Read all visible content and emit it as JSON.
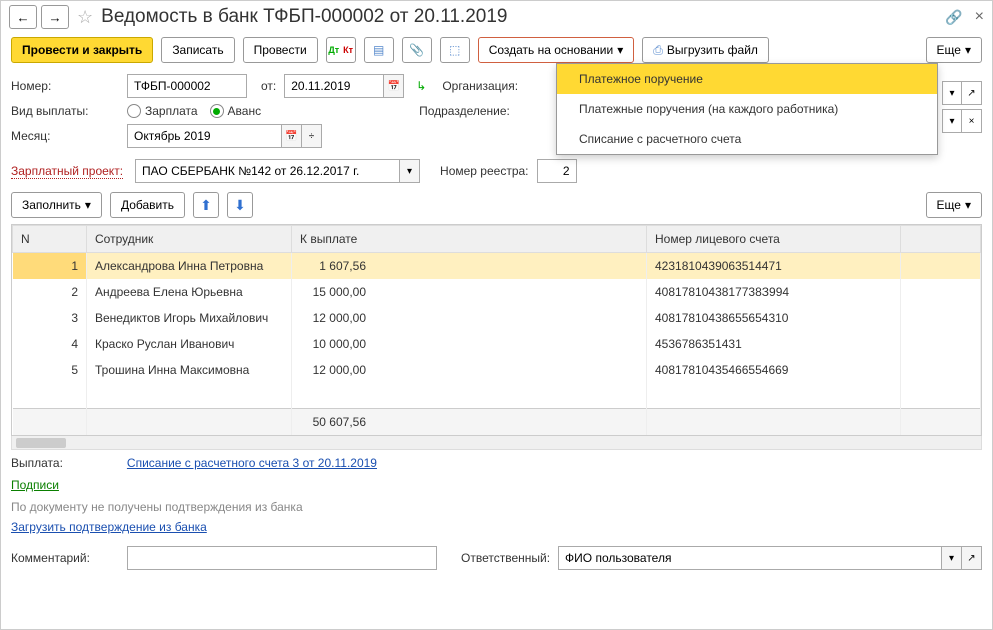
{
  "header": {
    "title": "Ведомость в банк ТФБП-000002 от 20.11.2019"
  },
  "toolbar": {
    "post_close": "Провести и закрыть",
    "save": "Записать",
    "post": "Провести",
    "create_based": "Создать на основании",
    "upload": "Выгрузить файл",
    "more": "Еще"
  },
  "dropdown": {
    "item1": "Платежное поручение",
    "item2": "Платежные поручения (на каждого работника)",
    "item3": "Списание с расчетного счета"
  },
  "form": {
    "number_label": "Номер:",
    "number_value": "ТФБП-000002",
    "from_label": "от:",
    "date_value": "20.11.2019",
    "org_label": "Организация:",
    "paytype_label": "Вид выплаты:",
    "radio_salary": "Зарплата",
    "radio_advance": "Аванс",
    "dept_label": "Подразделение:",
    "month_label": "Месяц:",
    "month_value": "Октябрь 2019",
    "project_label": "Зарплатный проект:",
    "project_value": "ПАО СБЕРБАНК №142 от 26.12.2017 г.",
    "registry_label": "Номер реестра:",
    "registry_value": "2"
  },
  "sec_toolbar": {
    "fill": "Заполнить",
    "add": "Добавить",
    "more2": "Еще"
  },
  "table": {
    "col_n": "N",
    "col_emp": "Сотрудник",
    "col_pay": "К выплате",
    "col_acc": "Номер лицевого счета",
    "rows": [
      {
        "n": "1",
        "emp": "Александрова Инна Петровна",
        "pay": "1 607,56",
        "acc": "4231810439063514471"
      },
      {
        "n": "2",
        "emp": "Андреева Елена Юрьевна",
        "pay": "15 000,00",
        "acc": "4081781043817738З994"
      },
      {
        "n": "3",
        "emp": "Венедиктов Игорь Михайлович",
        "pay": "12 000,00",
        "acc": "40817810438655654310"
      },
      {
        "n": "4",
        "emp": "Краско Руслан Иванович",
        "pay": "10 000,00",
        "acc": "4536786351431"
      },
      {
        "n": "5",
        "emp": "Трошина Инна Максимовна",
        "pay": "12 000,00",
        "acc": "40817810435466554669"
      }
    ],
    "total": "50 607,56"
  },
  "footer": {
    "payout_label": "Выплата:",
    "payout_link": "Списание с расчетного счета 3 от 20.11.2019",
    "signatures": "Подписи",
    "note": "По документу не получены подтверждения из банка",
    "load_link": "Загрузить подтверждение из банка",
    "comment_label": "Комментарий:",
    "resp_label": "Ответственный:",
    "resp_value": "ФИО пользователя"
  }
}
